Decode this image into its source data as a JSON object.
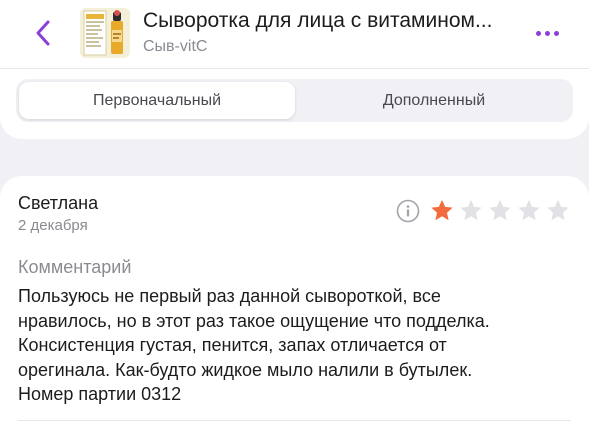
{
  "header": {
    "title": "Сыворотка для лица с витамином...",
    "subtitle": "Сыв-vitC"
  },
  "tabs": [
    {
      "label": "Первоначальный",
      "active": true
    },
    {
      "label": "Дополненный",
      "active": false
    }
  ],
  "review": {
    "author": "Светлана",
    "date": "2 декабря",
    "rating": 1,
    "max_rating": 5,
    "comment_label": "Комментарий",
    "comment": "Пользуюсь не первый раз данной сывороткой, все\nнравилось, но в этот раз такое ощущение что подделка.\nКонсистенция густая, пенится, запах отличается от\noрегинала. Как-будто жидкое мыло налили в бутылек.\nНомер партии 0312"
  },
  "icons": {
    "back": "chevron-left-icon",
    "more": "more-dots-icon",
    "info": "info-icon",
    "star": "star-icon"
  },
  "colors": {
    "accent": "#8b3fd9",
    "star_filled": "#f36a3d",
    "star_empty": "#e1e1e6"
  }
}
